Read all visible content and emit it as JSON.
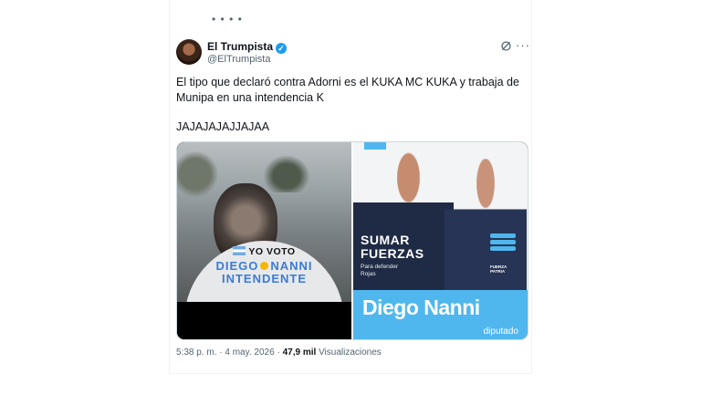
{
  "top_fragment": "• • • •",
  "tweet": {
    "author_name": "El Trumpista",
    "verified_mark": "✓",
    "handle": "@ElTrumpista",
    "more_label": "···",
    "text_line1": "El tipo que declaró contra Adorni es el KUKA MC KUKA y trabaja de Munipa en una intendencia K",
    "text_line2": "JAJAJAJAJJAJAA",
    "time": "5:38 p. m.",
    "date": "4 may. 2026",
    "separator": "·",
    "views_count": "47,9 mil",
    "views_label": "Visualizaciones"
  },
  "media": {
    "left": {
      "line1": "YO VOTO",
      "line2a": "DIEGO",
      "line2b": "NANNI",
      "line3": "INTENDENTE"
    },
    "right": {
      "headline1": "SUMAR",
      "headline2": "FUERZAS",
      "sub1": "Para defender",
      "sub2": "Rojas",
      "logo1": "FUERZA",
      "logo2": "PATRIA",
      "name": "Diego Nanni",
      "role": "diputado"
    }
  },
  "colors": {
    "verified": "#1d9bf0",
    "accent_blue": "#4fb7ee",
    "text_secondary": "#536471"
  },
  "icons": [
    "avatar",
    "verified-badge-icon",
    "grok-icon",
    "more-icon",
    "flag-icon",
    "sun-icon"
  ]
}
